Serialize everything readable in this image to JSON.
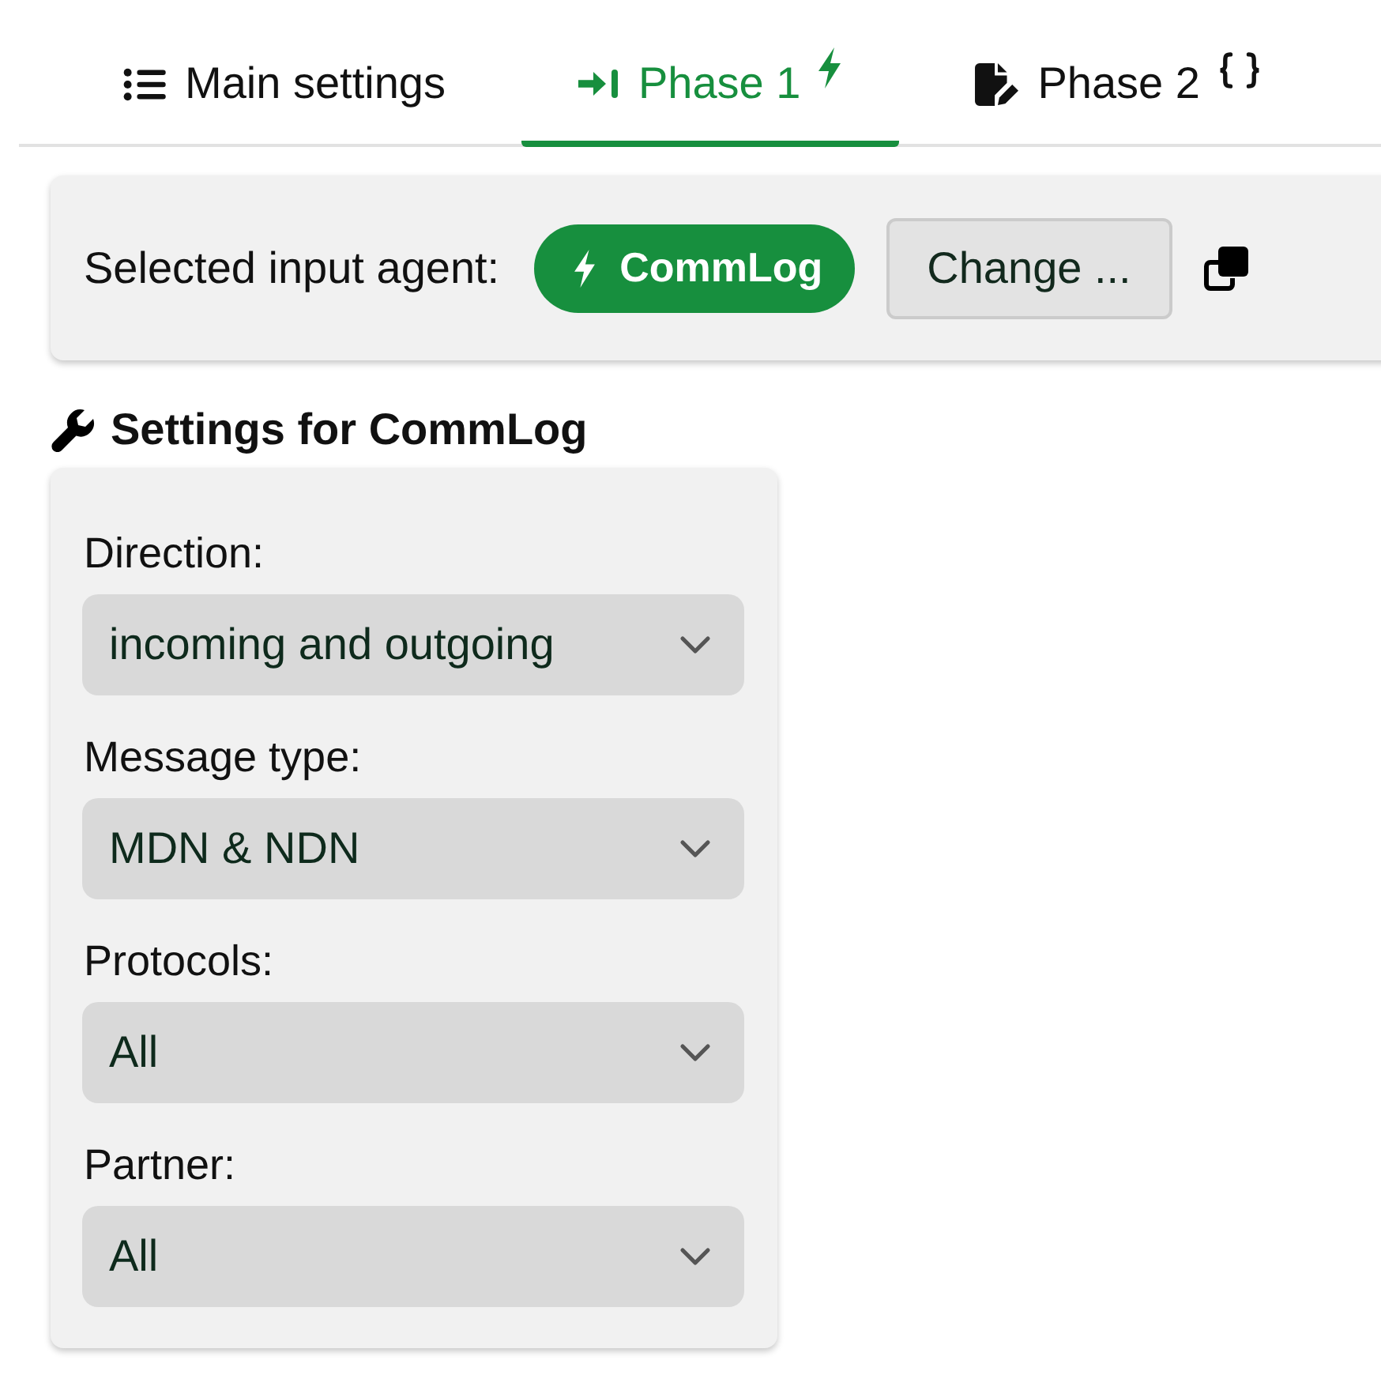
{
  "tabs": [
    {
      "label": "Main settings",
      "selected": false
    },
    {
      "label": "Phase 1",
      "selected": true
    },
    {
      "label": "Phase 2",
      "selected": false
    }
  ],
  "agent_panel": {
    "label": "Selected input agent:",
    "agent": "CommLog",
    "change_button": "Change ..."
  },
  "settings": {
    "heading": "Settings for CommLog",
    "fields": [
      {
        "label": "Direction:",
        "value": "incoming and outgoing"
      },
      {
        "label": "Message type:",
        "value": "MDN & NDN"
      },
      {
        "label": "Protocols:",
        "value": "All"
      },
      {
        "label": "Partner:",
        "value": "All"
      }
    ]
  }
}
